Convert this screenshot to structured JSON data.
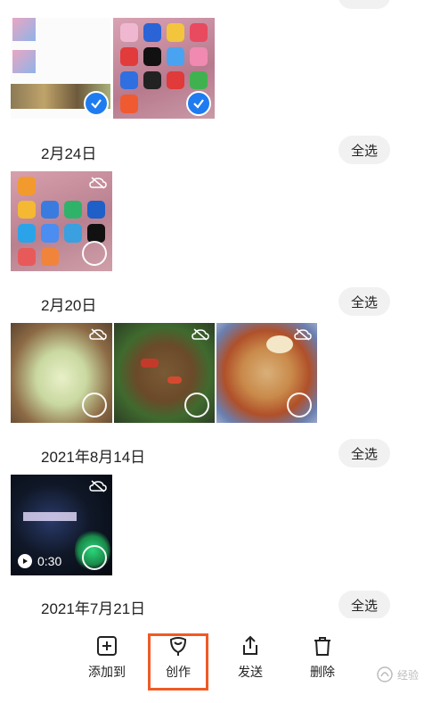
{
  "groups": [
    {
      "date": "2月24日",
      "select_all": "全选"
    },
    {
      "date": "2月20日",
      "select_all": "全选"
    },
    {
      "date": "2021年8月14日",
      "select_all": "全选"
    },
    {
      "date": "2021年7月21日",
      "select_all": "全选"
    }
  ],
  "video": {
    "duration": "0:30"
  },
  "toolbar": {
    "add_to": "添加到",
    "create": "创作",
    "send": "发送",
    "delete": "删除"
  },
  "watermark": {
    "text": "经验"
  },
  "colors": {
    "accent": "#1f7cf0",
    "highlight": "#f05a24",
    "pill_bg": "#f1f1f1"
  }
}
